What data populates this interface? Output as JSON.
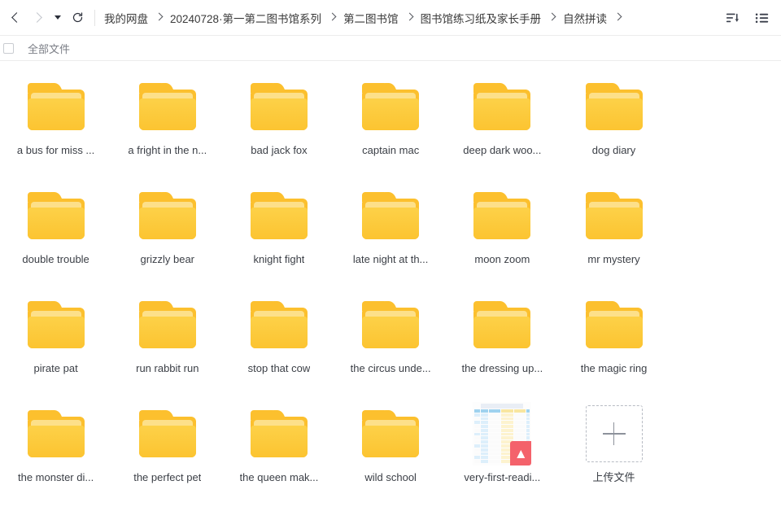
{
  "toolbar": {
    "back_icon": "chevron-left-icon",
    "forward_icon": "chevron-right-icon",
    "dropdown_icon": "caret-down-icon",
    "refresh_icon": "refresh-icon",
    "sort_icon": "sort-descending-icon",
    "view_icon": "list-view-icon"
  },
  "breadcrumb": {
    "items": [
      {
        "label": "我的网盘"
      },
      {
        "label": "20240728·第一第二图书馆系列"
      },
      {
        "label": "第二图书馆"
      },
      {
        "label": "图书馆练习纸及家长手册"
      },
      {
        "label": "自然拼读"
      }
    ]
  },
  "filterbar": {
    "checkbox_checked": false,
    "label": "全部文件"
  },
  "grid": {
    "items": [
      {
        "name": "a bus for miss ...",
        "type": "folder"
      },
      {
        "name": "a fright in the n...",
        "type": "folder"
      },
      {
        "name": "bad jack fox",
        "type": "folder"
      },
      {
        "name": "captain mac",
        "type": "folder"
      },
      {
        "name": "deep dark woo...",
        "type": "folder"
      },
      {
        "name": "dog diary",
        "type": "folder"
      },
      {
        "name": "double trouble",
        "type": "folder"
      },
      {
        "name": "grizzly bear",
        "type": "folder"
      },
      {
        "name": "knight fight",
        "type": "folder"
      },
      {
        "name": "late night at th...",
        "type": "folder"
      },
      {
        "name": "moon zoom",
        "type": "folder"
      },
      {
        "name": "mr mystery",
        "type": "folder"
      },
      {
        "name": "pirate pat",
        "type": "folder"
      },
      {
        "name": "run rabbit run",
        "type": "folder"
      },
      {
        "name": "stop that cow",
        "type": "folder"
      },
      {
        "name": "the circus unde...",
        "type": "folder"
      },
      {
        "name": "the dressing up...",
        "type": "folder"
      },
      {
        "name": "the magic ring",
        "type": "folder"
      },
      {
        "name": "the monster di...",
        "type": "folder"
      },
      {
        "name": "the perfect pet",
        "type": "folder"
      },
      {
        "name": "the queen mak...",
        "type": "folder"
      },
      {
        "name": "wild school",
        "type": "folder"
      },
      {
        "name": "very-first-readi...",
        "type": "pdf",
        "badge": "PDF"
      },
      {
        "name": "上传文件",
        "type": "upload"
      }
    ]
  },
  "colors": {
    "folder_body": "#fdca3a",
    "folder_back": "#fcc02e",
    "folder_sheet": "#fde08a",
    "pdf_badge": "#f4626b",
    "text": "#3b3f46",
    "muted": "#7a7d85"
  }
}
